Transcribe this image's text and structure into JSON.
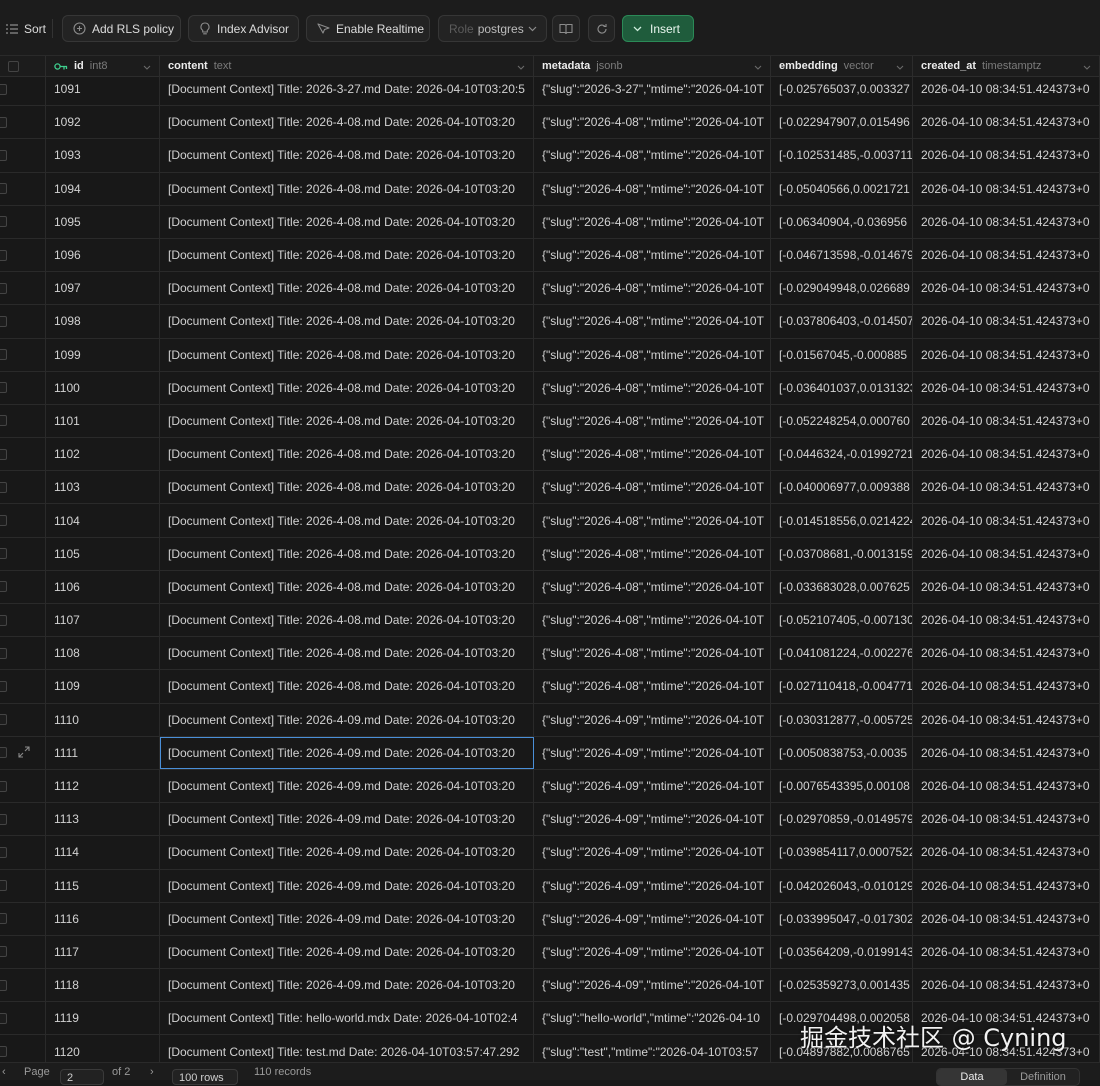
{
  "toolbar": {
    "sort_label": "Sort",
    "add_rls_label": "Add RLS policy",
    "index_advisor_label": "Index Advisor",
    "enable_realtime_label": "Enable Realtime",
    "role_label": "Role",
    "role_value": "postgres",
    "insert_label": "Insert",
    "icons": [
      "list-icon",
      "plus-circle-icon",
      "lightbulb-icon",
      "realtime-icon",
      "chevron-down-icon",
      "book-icon",
      "refresh-icon"
    ]
  },
  "columns": [
    {
      "name": "id",
      "type": "int8",
      "primary_key": true
    },
    {
      "name": "content",
      "type": "text"
    },
    {
      "name": "metadata",
      "type": "jsonb"
    },
    {
      "name": "embedding",
      "type": "vector"
    },
    {
      "name": "created_at",
      "type": "timestamptz"
    }
  ],
  "rows": [
    {
      "id": "1091",
      "content": "[Document Context] Title: 2026-3-27.md Date: 2026-04-10T03:20:5",
      "metadata": "{\"slug\":\"2026-3-27\",\"mtime\":\"2026-04-10T",
      "embedding": "[-0.025765037,0.003327",
      "created_at": "2026-04-10 08:34:51.424373+0"
    },
    {
      "id": "1092",
      "content": "[Document Context] Title: 2026-4-08.md Date: 2026-04-10T03:20",
      "metadata": "{\"slug\":\"2026-4-08\",\"mtime\":\"2026-04-10T",
      "embedding": "[-0.022947907,0.015496",
      "created_at": "2026-04-10 08:34:51.424373+0"
    },
    {
      "id": "1093",
      "content": "[Document Context] Title: 2026-4-08.md Date: 2026-04-10T03:20",
      "metadata": "{\"slug\":\"2026-4-08\",\"mtime\":\"2026-04-10T",
      "embedding": "[-0.102531485,-0.0037113",
      "created_at": "2026-04-10 08:34:51.424373+0"
    },
    {
      "id": "1094",
      "content": "[Document Context] Title: 2026-4-08.md Date: 2026-04-10T03:20",
      "metadata": "{\"slug\":\"2026-4-08\",\"mtime\":\"2026-04-10T",
      "embedding": "[-0.05040566,0.0021721",
      "created_at": "2026-04-10 08:34:51.424373+0"
    },
    {
      "id": "1095",
      "content": "[Document Context] Title: 2026-4-08.md Date: 2026-04-10T03:20",
      "metadata": "{\"slug\":\"2026-4-08\",\"mtime\":\"2026-04-10T",
      "embedding": "[-0.06340904,-0.036956",
      "created_at": "2026-04-10 08:34:51.424373+0"
    },
    {
      "id": "1096",
      "content": "[Document Context] Title: 2026-4-08.md Date: 2026-04-10T03:20",
      "metadata": "{\"slug\":\"2026-4-08\",\"mtime\":\"2026-04-10T",
      "embedding": "[-0.046713598,-0.014679",
      "created_at": "2026-04-10 08:34:51.424373+0"
    },
    {
      "id": "1097",
      "content": "[Document Context] Title: 2026-4-08.md Date: 2026-04-10T03:20",
      "metadata": "{\"slug\":\"2026-4-08\",\"mtime\":\"2026-04-10T",
      "embedding": "[-0.029049948,0.026689",
      "created_at": "2026-04-10 08:34:51.424373+0"
    },
    {
      "id": "1098",
      "content": "[Document Context] Title: 2026-4-08.md Date: 2026-04-10T03:20",
      "metadata": "{\"slug\":\"2026-4-08\",\"mtime\":\"2026-04-10T",
      "embedding": "[-0.037806403,-0.014507",
      "created_at": "2026-04-10 08:34:51.424373+0"
    },
    {
      "id": "1099",
      "content": "[Document Context] Title: 2026-4-08.md Date: 2026-04-10T03:20",
      "metadata": "{\"slug\":\"2026-4-08\",\"mtime\":\"2026-04-10T",
      "embedding": "[-0.01567045,-0.000885",
      "created_at": "2026-04-10 08:34:51.424373+0"
    },
    {
      "id": "1100",
      "content": "[Document Context] Title: 2026-4-08.md Date: 2026-04-10T03:20",
      "metadata": "{\"slug\":\"2026-4-08\",\"mtime\":\"2026-04-10T",
      "embedding": "[-0.036401037,0.0131323",
      "created_at": "2026-04-10 08:34:51.424373+0"
    },
    {
      "id": "1101",
      "content": "[Document Context] Title: 2026-4-08.md Date: 2026-04-10T03:20",
      "metadata": "{\"slug\":\"2026-4-08\",\"mtime\":\"2026-04-10T",
      "embedding": "[-0.052248254,0.000760",
      "created_at": "2026-04-10 08:34:51.424373+0"
    },
    {
      "id": "1102",
      "content": "[Document Context] Title: 2026-4-08.md Date: 2026-04-10T03:20",
      "metadata": "{\"slug\":\"2026-4-08\",\"mtime\":\"2026-04-10T",
      "embedding": "[-0.0446324,-0.01992721",
      "created_at": "2026-04-10 08:34:51.424373+0"
    },
    {
      "id": "1103",
      "content": "[Document Context] Title: 2026-4-08.md Date: 2026-04-10T03:20",
      "metadata": "{\"slug\":\"2026-4-08\",\"mtime\":\"2026-04-10T",
      "embedding": "[-0.040006977,0.009388",
      "created_at": "2026-04-10 08:34:51.424373+0"
    },
    {
      "id": "1104",
      "content": "[Document Context] Title: 2026-4-08.md Date: 2026-04-10T03:20",
      "metadata": "{\"slug\":\"2026-4-08\",\"mtime\":\"2026-04-10T",
      "embedding": "[-0.014518556,0.0214224",
      "created_at": "2026-04-10 08:34:51.424373+0"
    },
    {
      "id": "1105",
      "content": "[Document Context] Title: 2026-4-08.md Date: 2026-04-10T03:20",
      "metadata": "{\"slug\":\"2026-4-08\",\"mtime\":\"2026-04-10T",
      "embedding": "[-0.03708681,-0.0013159",
      "created_at": "2026-04-10 08:34:51.424373+0"
    },
    {
      "id": "1106",
      "content": "[Document Context] Title: 2026-4-08.md Date: 2026-04-10T03:20",
      "metadata": "{\"slug\":\"2026-4-08\",\"mtime\":\"2026-04-10T",
      "embedding": "[-0.033683028,0.007625",
      "created_at": "2026-04-10 08:34:51.424373+0"
    },
    {
      "id": "1107",
      "content": "[Document Context] Title: 2026-4-08.md Date: 2026-04-10T03:20",
      "metadata": "{\"slug\":\"2026-4-08\",\"mtime\":\"2026-04-10T",
      "embedding": "[-0.052107405,-0.007130",
      "created_at": "2026-04-10 08:34:51.424373+0"
    },
    {
      "id": "1108",
      "content": "[Document Context] Title: 2026-4-08.md Date: 2026-04-10T03:20",
      "metadata": "{\"slug\":\"2026-4-08\",\"mtime\":\"2026-04-10T",
      "embedding": "[-0.041081224,-0.002276",
      "created_at": "2026-04-10 08:34:51.424373+0"
    },
    {
      "id": "1109",
      "content": "[Document Context] Title: 2026-4-08.md Date: 2026-04-10T03:20",
      "metadata": "{\"slug\":\"2026-4-08\",\"mtime\":\"2026-04-10T",
      "embedding": "[-0.027110418,-0.0047717",
      "created_at": "2026-04-10 08:34:51.424373+0"
    },
    {
      "id": "1110",
      "content": "[Document Context] Title: 2026-4-09.md Date: 2026-04-10T03:20",
      "metadata": "{\"slug\":\"2026-4-09\",\"mtime\":\"2026-04-10T",
      "embedding": "[-0.030312877,-0.005725",
      "created_at": "2026-04-10 08:34:51.424373+0"
    },
    {
      "id": "1111",
      "content": "[Document Context] Title: 2026-4-09.md Date: 2026-04-10T03:20",
      "metadata": "{\"slug\":\"2026-4-09\",\"mtime\":\"2026-04-10T",
      "embedding": "[-0.0050838753,-0.0035",
      "created_at": "2026-04-10 08:34:51.424373+0",
      "selected": true
    },
    {
      "id": "1112",
      "content": "[Document Context] Title: 2026-4-09.md Date: 2026-04-10T03:20",
      "metadata": "{\"slug\":\"2026-4-09\",\"mtime\":\"2026-04-10T",
      "embedding": "[-0.0076543395,0.00108",
      "created_at": "2026-04-10 08:34:51.424373+0"
    },
    {
      "id": "1113",
      "content": "[Document Context] Title: 2026-4-09.md Date: 2026-04-10T03:20",
      "metadata": "{\"slug\":\"2026-4-09\",\"mtime\":\"2026-04-10T",
      "embedding": "[-0.02970859,-0.0149579",
      "created_at": "2026-04-10 08:34:51.424373+0"
    },
    {
      "id": "1114",
      "content": "[Document Context] Title: 2026-4-09.md Date: 2026-04-10T03:20",
      "metadata": "{\"slug\":\"2026-4-09\",\"mtime\":\"2026-04-10T",
      "embedding": "[-0.039854117,0.0007522",
      "created_at": "2026-04-10 08:34:51.424373+0"
    },
    {
      "id": "1115",
      "content": "[Document Context] Title: 2026-4-09.md Date: 2026-04-10T03:20",
      "metadata": "{\"slug\":\"2026-4-09\",\"mtime\":\"2026-04-10T",
      "embedding": "[-0.042026043,-0.010129",
      "created_at": "2026-04-10 08:34:51.424373+0"
    },
    {
      "id": "1116",
      "content": "[Document Context] Title: 2026-4-09.md Date: 2026-04-10T03:20",
      "metadata": "{\"slug\":\"2026-4-09\",\"mtime\":\"2026-04-10T",
      "embedding": "[-0.033995047,-0.017302",
      "created_at": "2026-04-10 08:34:51.424373+0"
    },
    {
      "id": "1117",
      "content": "[Document Context] Title: 2026-4-09.md Date: 2026-04-10T03:20",
      "metadata": "{\"slug\":\"2026-4-09\",\"mtime\":\"2026-04-10T",
      "embedding": "[-0.03564209,-0.0199143",
      "created_at": "2026-04-10 08:34:51.424373+0"
    },
    {
      "id": "1118",
      "content": "[Document Context] Title: 2026-4-09.md Date: 2026-04-10T03:20",
      "metadata": "{\"slug\":\"2026-4-09\",\"mtime\":\"2026-04-10T",
      "embedding": "[-0.025359273,0.001435",
      "created_at": "2026-04-10 08:34:51.424373+0"
    },
    {
      "id": "1119",
      "content": "[Document Context] Title: hello-world.mdx Date: 2026-04-10T02:4",
      "metadata": "{\"slug\":\"hello-world\",\"mtime\":\"2026-04-10",
      "embedding": "[-0.029704498,0.002058",
      "created_at": "2026-04-10 08:34:51.424373+0"
    },
    {
      "id": "1120",
      "content": "[Document Context] Title: test.md Date: 2026-04-10T03:57:47.292",
      "metadata": "{\"slug\":\"test\",\"mtime\":\"2026-04-10T03:57",
      "embedding": "[-0.04897882,0.0086765",
      "created_at": "2026-04-10 08:34:51.424373+0"
    }
  ],
  "footer": {
    "page_label": "Page",
    "page_value": "2",
    "of_label": "of 2",
    "rows_select": "100 rows",
    "records": "110 records",
    "view_data": "Data",
    "view_definition": "Definition"
  },
  "watermark": "掘金技术社区 @ Cyning",
  "colors": {
    "background": "#181818",
    "accent_green": "#3ecf8e",
    "insert_button": "#1f5c3c",
    "selection_border": "#4a8fd8"
  }
}
